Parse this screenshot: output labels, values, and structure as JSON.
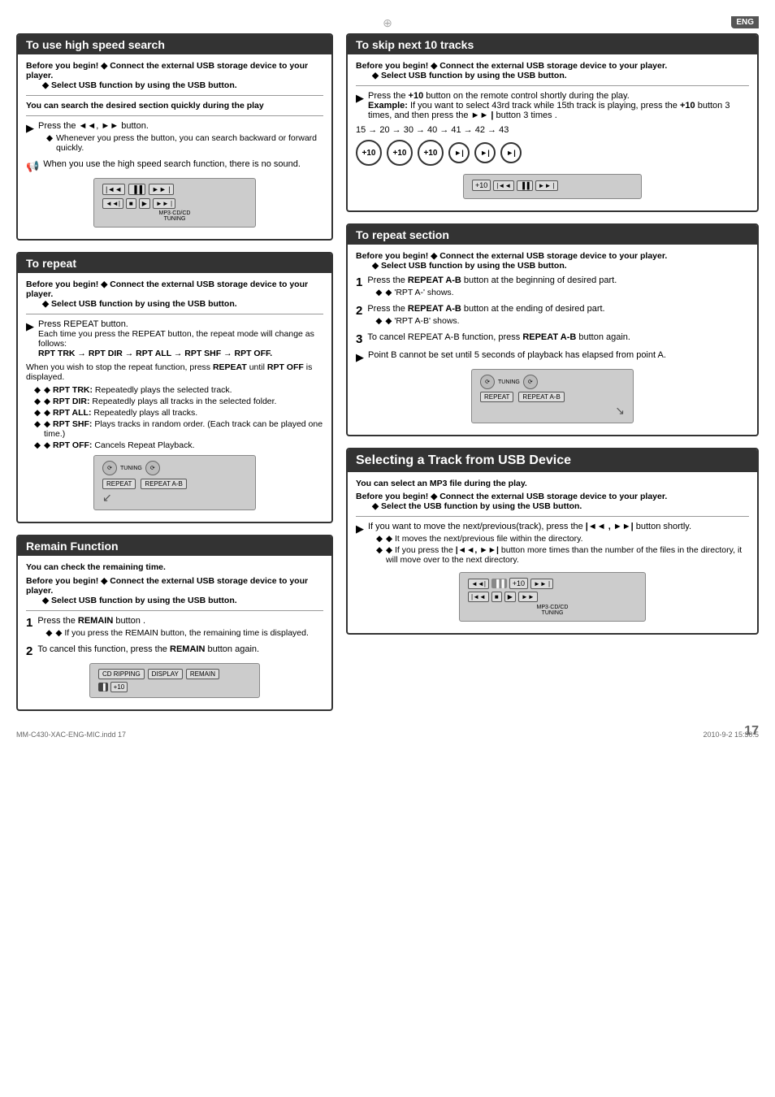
{
  "page": {
    "number": "17",
    "eng_badge": "ENG",
    "footer_left": "MM-C430-XAC-ENG-MIC.indd   17",
    "footer_right": "2010-9-2   15:30:5"
  },
  "crosshair": "+",
  "sections": {
    "high_speed_search": {
      "title": "To use high speed search",
      "before_begin_label": "Before you begin!",
      "before_begin_lines": [
        "◆ Connect the external USB storage device to your player.",
        "◆ Select USB function by using the USB button."
      ],
      "description": "You can search the desired section quickly during the play",
      "step1": "Press the ◄◄, ►► button.",
      "step1_bullets": [
        "Whenever you press the button, you can search backward or forward quickly."
      ],
      "note": "When you use the high speed search function, there is no sound."
    },
    "to_repeat": {
      "title": "To repeat",
      "before_begin_label": "Before you begin!",
      "before_begin_lines": [
        "◆ Connect the external USB storage device to your player.",
        "◆ Select USB function by using the USB button."
      ],
      "step1": "Press REPEAT button.",
      "step1_detail": "Each time you press the REPEAT button, the repeat mode will change as follows:",
      "sequence": "RPT TRK → RPT DIR → RPT ALL → RPT SHF → RPT OFF.",
      "note": "When you wish to stop the repeat function, press REPEAT until RPT OFF is displayed.",
      "bullets": [
        "RPT TRK: Repeatedly plays the selected track.",
        "RPT DIR: Repeatedly plays all tracks in the selected folder.",
        "RPT ALL: Repeatedly plays all tracks.",
        "RPT SHF: Plays tracks in random order. (Each track can be played one time.)",
        "RPT OFF: Cancels Repeat Playback."
      ]
    },
    "remain_function": {
      "title": "Remain Function",
      "description": "You can check the remaining time.",
      "before_begin_label": "Before you begin!",
      "before_begin_lines": [
        "◆ Connect the external USB storage device to your player.",
        "◆ Select USB function by using the USB button."
      ],
      "step1_label": "1",
      "step1": "Press the REMAIN button .",
      "step1_bullet": "If you press the REMAIN button, the remaining time is displayed.",
      "step2_label": "2",
      "step2": "To cancel this function, press the REMAIN button again."
    },
    "skip_next": {
      "title": "To skip next 10 tracks",
      "before_begin_label": "Before you begin!",
      "before_begin_lines": [
        "◆ Connect the external USB storage device to your player.",
        "◆ Select USB function by using the USB button."
      ],
      "step1": "Press the +10 button on the remote control shortly during the play.",
      "example_label": "Example:",
      "example_text": "If you want to select 43rd track while 15th track is playing, press the +10 button 3 times, and then press the ►► button 3 times .",
      "sequence": "15 → 20 → 30 → 40 → 41 → 42 → 43",
      "skip_buttons": [
        "+10",
        "+10",
        "+10",
        "►|",
        "►|",
        "►|"
      ]
    },
    "repeat_section": {
      "title": "To repeat section",
      "before_begin_label": "Before you begin!",
      "before_begin_lines": [
        "◆ Connect the external USB storage device to your player.",
        "◆ Select USB function by using the USB button."
      ],
      "step1_label": "1",
      "step1": "Press the REPEAT A-B button at the beginning of desired part.",
      "step1_bullet": "'RPT A-' shows.",
      "step2_label": "2",
      "step2": "Press the REPEAT A-B button at the ending of desired part.",
      "step2_bullet": "'RPT A-B' shows.",
      "step3_label": "3",
      "step3": "To cancel REPEAT A-B function, press REPEAT A-B button again.",
      "note": "Point B cannot be set until 5 seconds of playback has elapsed from point A."
    },
    "selecting_track": {
      "title": "Selecting a Track from USB Device",
      "description": "You can select an MP3 file during the play.",
      "before_begin_label": "Before you begin!",
      "before_begin_lines": [
        "◆ Connect the external USB storage device to your player.",
        "◆ Select the USB function by using the USB button."
      ],
      "step1": "If you want to move the next/previous(track), press the |◄◄ , ►►| button shortly.",
      "step1_bullets": [
        "It moves the next/previous file within the directory.",
        "If you press the |◄◄, ►►| button more times than the number of the files in the directory, it will move over to the next directory."
      ]
    }
  }
}
